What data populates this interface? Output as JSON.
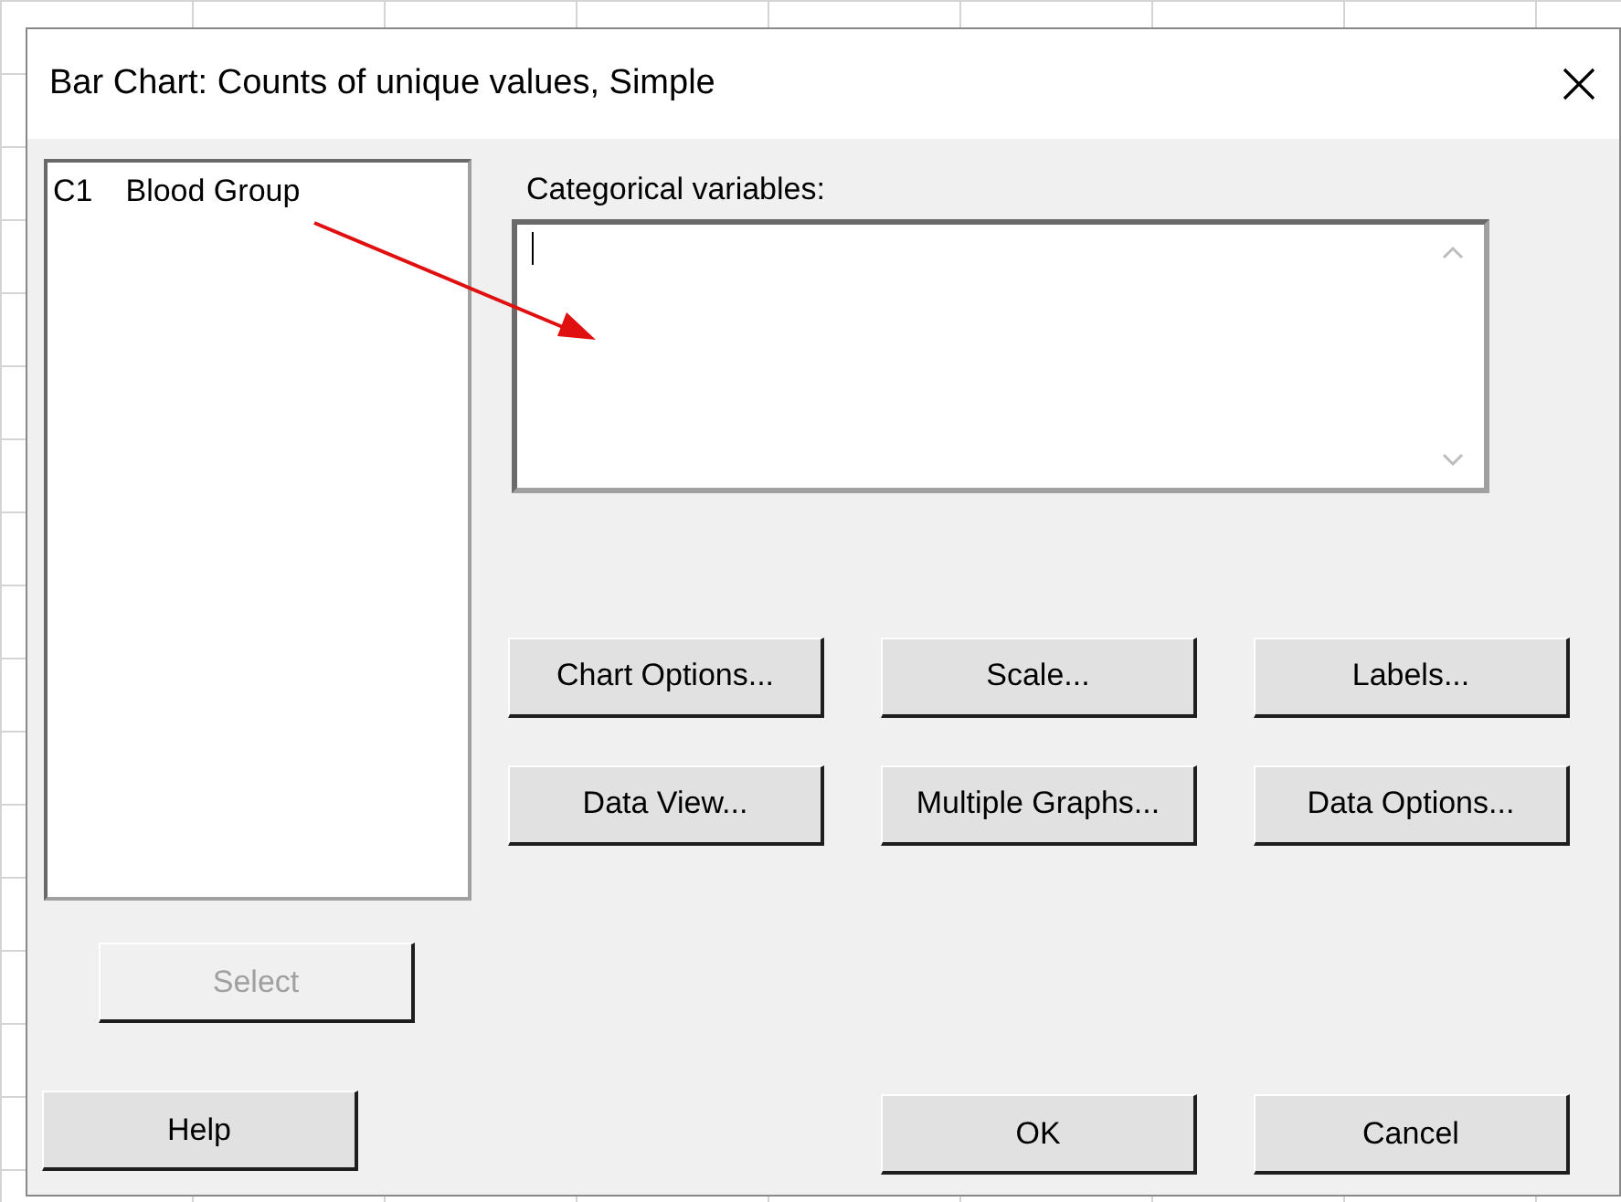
{
  "window": {
    "title": "Bar Chart: Counts of unique values, Simple"
  },
  "variables_list": {
    "items": [
      {
        "column": "C1",
        "name": "Blood Group"
      }
    ]
  },
  "categorical_variables": {
    "label": "Categorical variables:"
  },
  "option_buttons": [
    {
      "label": "Chart Options..."
    },
    {
      "label": "Scale..."
    },
    {
      "label": "Labels..."
    },
    {
      "label": "Data View..."
    },
    {
      "label": "Multiple Graphs..."
    },
    {
      "label": "Data Options..."
    }
  ],
  "select_button": {
    "label": "Select",
    "disabled": true
  },
  "footer_buttons": [
    {
      "label": "Help",
      "kind": "left"
    },
    {
      "label": "OK",
      "kind": "right"
    },
    {
      "label": "Cancel",
      "kind": "right"
    }
  ]
}
